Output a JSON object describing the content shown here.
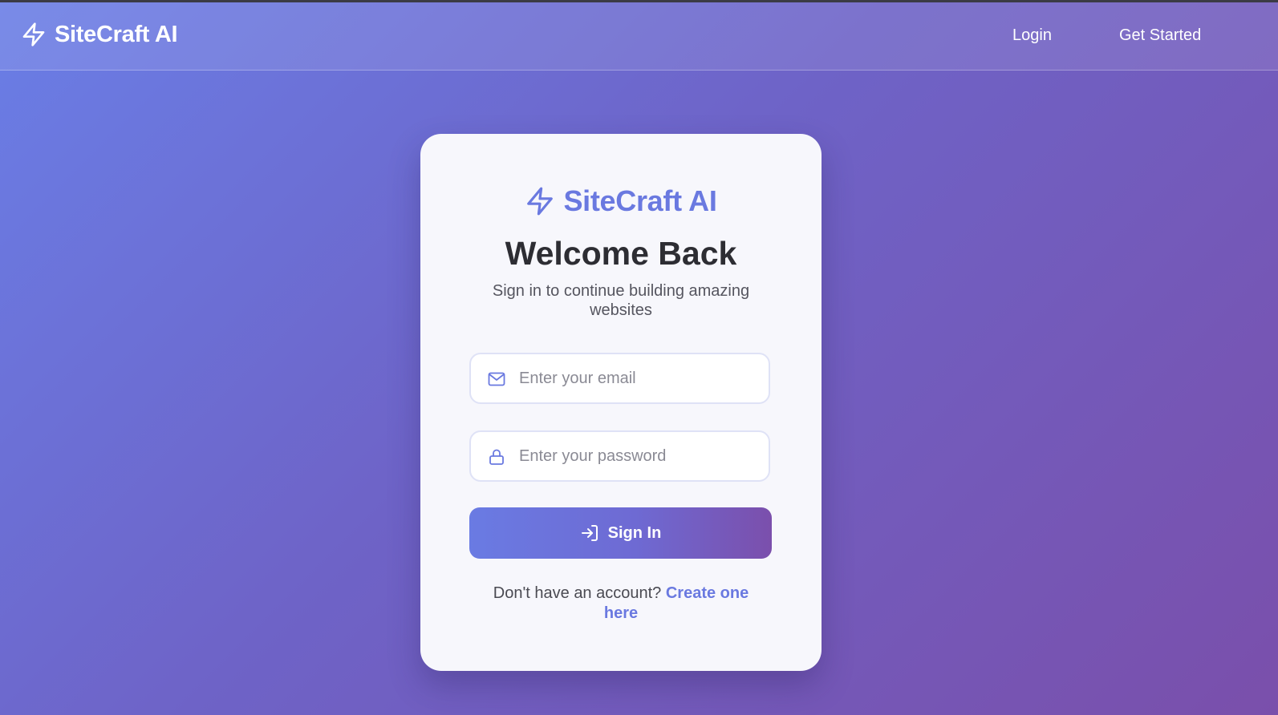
{
  "nav": {
    "brand": "SiteCraft AI",
    "brand_icon": "lightning-bolt-icon",
    "login_label": "Login",
    "get_started_label": "Get Started"
  },
  "card": {
    "brand": "SiteCraft AI",
    "brand_icon": "lightning-bolt-icon",
    "title": "Welcome Back",
    "subtitle": "Sign in to continue building amazing websites",
    "email": {
      "icon": "mail-icon",
      "placeholder": "Enter your email",
      "value": ""
    },
    "password": {
      "icon": "lock-icon",
      "placeholder": "Enter your password",
      "value": ""
    },
    "signin": {
      "icon": "sign-in-icon",
      "label": "Sign In"
    },
    "footer": {
      "prompt": "Don't have an account?",
      "link": "Create one here"
    }
  },
  "colors": {
    "accent": "#6a79e0",
    "gradient_start": "#6a7ee6",
    "gradient_end": "#7a4fab",
    "card_bg": "#f7f7fc",
    "title": "#2d2d33"
  }
}
